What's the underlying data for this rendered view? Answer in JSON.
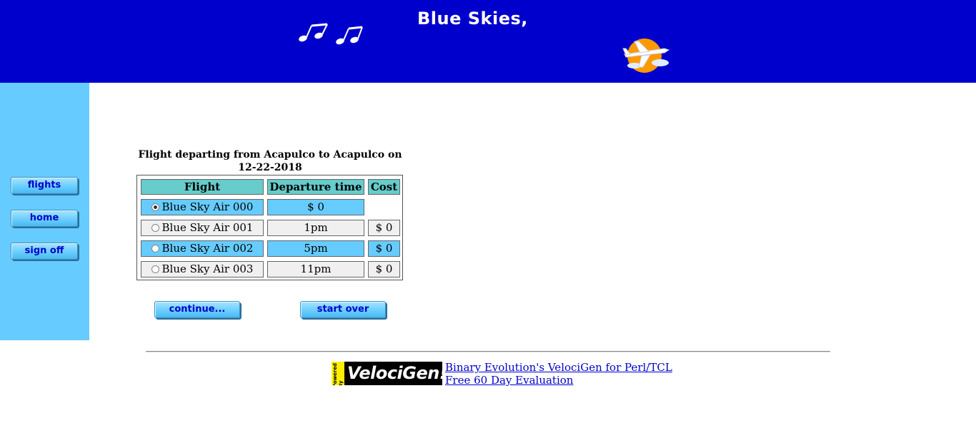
{
  "banner": {
    "title": "Blue Skies,"
  },
  "sidebar": {
    "items": [
      {
        "label": "flights"
      },
      {
        "label": "home"
      },
      {
        "label": "sign off"
      }
    ]
  },
  "flight_selection": {
    "caption": "Flight departing from Acapulco to Acapulco on 12-22-2018",
    "headers": {
      "flight": "Flight",
      "departure_time": "Departure time",
      "cost": "Cost"
    },
    "rows": [
      {
        "flight": "Blue Sky Air 000",
        "departure_time": "$ 0",
        "cost": "",
        "selected": true
      },
      {
        "flight": "Blue Sky Air 001",
        "departure_time": "1pm",
        "cost": "$ 0",
        "selected": false
      },
      {
        "flight": "Blue Sky Air 002",
        "departure_time": "5pm",
        "cost": "$ 0",
        "selected": false
      },
      {
        "flight": "Blue Sky Air 003",
        "departure_time": "11pm",
        "cost": "$ 0",
        "selected": false
      }
    ]
  },
  "actions": {
    "continue_label": "continue...",
    "start_over_label": "start over"
  },
  "footer": {
    "logo_text": "VelociGen!",
    "logo_badge": "Powered By",
    "link1": "Binary Evolution's VelociGen for Perl/TCL",
    "link2": "Free 60 Day Evaluation"
  },
  "colors": {
    "banner": "#0000cc",
    "sidebar": "#66ccff",
    "header_cell": "#66cccc",
    "row_highlight": "#66ccff"
  }
}
